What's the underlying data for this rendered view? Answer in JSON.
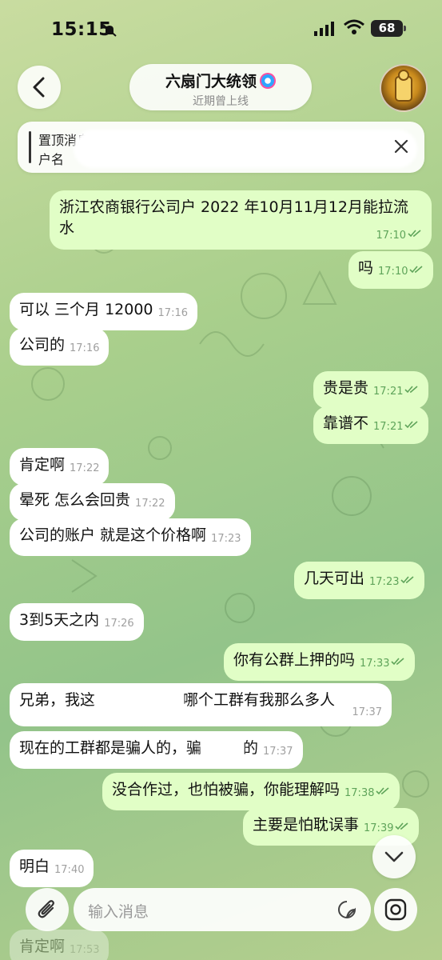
{
  "status_bar": {
    "time": "15:15",
    "battery": "68"
  },
  "header": {
    "title": "六扇门大统领",
    "subtitle": "近期曾上线"
  },
  "pinned": {
    "label": "置顶消息",
    "preview": "户名"
  },
  "messages": [
    {
      "dir": "out",
      "text": "浙江农商银行公司户 2022 年10月11月12月能拉流水",
      "time": "17:10"
    },
    {
      "dir": "out",
      "text": "吗",
      "time": "17:10"
    },
    {
      "dir": "in",
      "text": "可以 三个月 12000",
      "time": "17:16"
    },
    {
      "dir": "in",
      "text": "公司的",
      "time": "17:16"
    },
    {
      "dir": "out",
      "text": "贵是贵",
      "time": "17:21"
    },
    {
      "dir": "out",
      "text": "靠谱不",
      "time": "17:21"
    },
    {
      "dir": "in",
      "text": "肯定啊",
      "time": "17:22"
    },
    {
      "dir": "in",
      "text": "晕死 怎么会回贵",
      "time": "17:22"
    },
    {
      "dir": "in",
      "text": "公司的账户 就是这个价格啊",
      "time": "17:23"
    },
    {
      "dir": "out",
      "text": "几天可出",
      "time": "17:23"
    },
    {
      "dir": "in",
      "text": "3到5天之内",
      "time": "17:26"
    },
    {
      "dir": "out",
      "text": "你有公群上押的吗",
      "time": "17:33"
    },
    {
      "dir": "in",
      "text_a": "兄弟，我这",
      "text_b": "哪个工群有我那么多人",
      "time": "17:37"
    },
    {
      "dir": "in",
      "text_a": "现在的工群都是骗人的，骗",
      "text_b": "的",
      "time": "17:37"
    },
    {
      "dir": "out",
      "text": "没合作过，也怕被骗，你能理解吗",
      "time": "17:38"
    },
    {
      "dir": "out",
      "text": "主要是怕耽误事",
      "time": "17:39"
    },
    {
      "dir": "in",
      "text": "明白",
      "time": "17:40"
    },
    {
      "dir": "in",
      "text": "肯定啊",
      "time": "17:53"
    }
  ],
  "input": {
    "placeholder": "输入消息"
  },
  "icons": {
    "back": "chevron-left-icon",
    "close": "close-icon",
    "attach": "paperclip-icon",
    "sticker": "sticker-icon",
    "camera": "camera-icon",
    "scroll": "chevron-down-icon"
  },
  "colors": {
    "incoming": "#ffffff",
    "outgoing": "#e1fec6",
    "time_out": "#5fa45a"
  }
}
